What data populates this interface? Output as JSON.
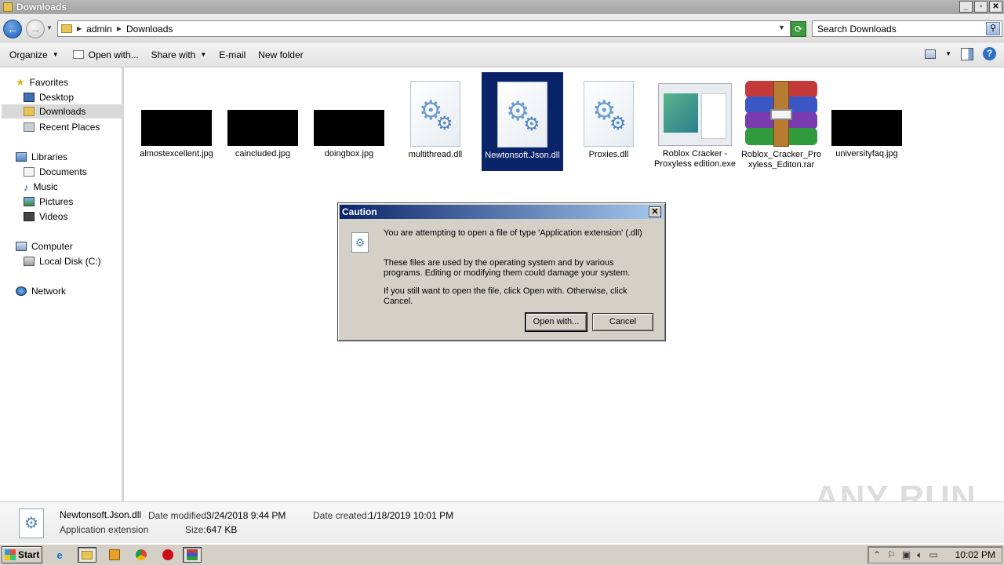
{
  "window": {
    "title": "Downloads"
  },
  "window_buttons": {
    "minimize": "_",
    "maximize": "▫",
    "close": "✕"
  },
  "address": {
    "crumbs": [
      "admin",
      "Downloads"
    ]
  },
  "search": {
    "placeholder": "Search Downloads"
  },
  "toolbar": {
    "organize": "Organize",
    "open_with": "Open with...",
    "share_with": "Share with",
    "email": "E-mail",
    "new_folder": "New folder"
  },
  "nav": {
    "favorites": "Favorites",
    "desktop": "Desktop",
    "downloads": "Downloads",
    "recent_places": "Recent Places",
    "libraries": "Libraries",
    "documents": "Documents",
    "music": "Music",
    "pictures": "Pictures",
    "videos": "Videos",
    "computer": "Computer",
    "local_disk": "Local Disk (C:)",
    "network": "Network"
  },
  "files": [
    {
      "name": "almostexcellent.jpg",
      "kind": "image-black"
    },
    {
      "name": "caincluded.jpg",
      "kind": "image-black"
    },
    {
      "name": "doingbox.jpg",
      "kind": "image-black"
    },
    {
      "name": "multithread.dll",
      "kind": "dll"
    },
    {
      "name": "Newtonsoft.Json.dll",
      "kind": "dll",
      "selected": true
    },
    {
      "name": "Proxies.dll",
      "kind": "dll"
    },
    {
      "name": "Roblox Cracker -Proxyless edition.exe",
      "kind": "exe"
    },
    {
      "name": "Roblox_Cracker_Proxyless_Editon.rar",
      "kind": "rar"
    },
    {
      "name": "universityfaq.jpg",
      "kind": "image-black"
    }
  ],
  "dialog": {
    "title": "Caution",
    "line1": "You are attempting to open a file of type 'Application extension' (.dll)",
    "line2": "These files are used by the operating system and by various programs. Editing or modifying them could damage your system.",
    "line3": "If you still want to open the file, click Open with. Otherwise, click Cancel.",
    "open_with_btn": "Open with...",
    "cancel_btn": "Cancel"
  },
  "details": {
    "filename": "Newtonsoft.Json.dll",
    "type": "Application extension",
    "date_modified_label": "Date modified:",
    "date_modified": "3/24/2018 9:44 PM",
    "size_label": "Size:",
    "size": "647 KB",
    "date_created_label": "Date created:",
    "date_created": "1/18/2019 10:01 PM"
  },
  "watermark": "ANY RUN",
  "taskbar": {
    "start": "Start",
    "clock": "10:02 PM"
  }
}
